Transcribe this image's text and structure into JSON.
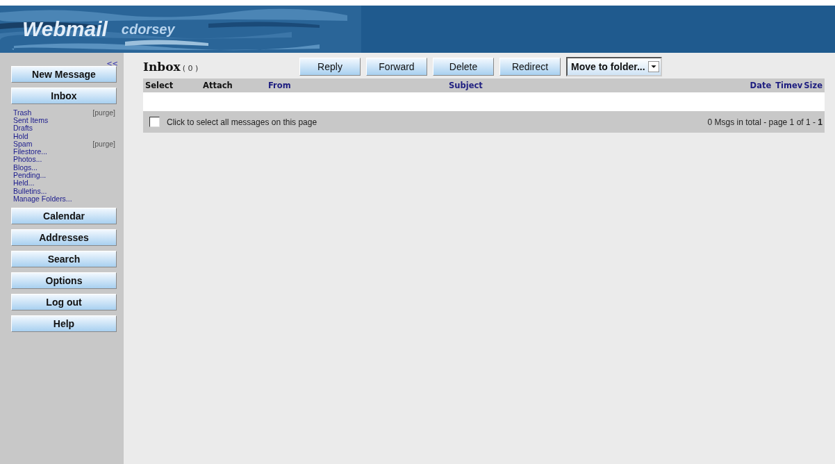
{
  "header": {
    "app_name": "Webmail",
    "user": "cdorsey"
  },
  "sidebar": {
    "collapse": "<<",
    "top_buttons": [
      "New Message",
      "Inbox"
    ],
    "folders": [
      {
        "name": "Trash",
        "action": "[purge]"
      },
      {
        "name": "Sent Items"
      },
      {
        "name": "Drafts"
      },
      {
        "name": "Hold"
      },
      {
        "name": "Spam",
        "action": "[purge]"
      },
      {
        "name": "Filestore..."
      },
      {
        "name": "Photos..."
      },
      {
        "name": "Blogs..."
      },
      {
        "name": "Pending..."
      },
      {
        "name": "Held..."
      },
      {
        "name": "Bulletins..."
      },
      {
        "name": "Manage Folders..."
      }
    ],
    "bottom_buttons": [
      "Calendar",
      "Addresses",
      "Search",
      "Options",
      "Log out",
      "Help"
    ]
  },
  "mailbox": {
    "title": "Inbox",
    "count": "( 0 )"
  },
  "toolbar": {
    "buttons": [
      "Reply",
      "Forward",
      "Delete",
      "Redirect"
    ],
    "move_select": "Move to folder..."
  },
  "table": {
    "columns": [
      {
        "label": "Select",
        "kind": "plain"
      },
      {
        "label": "Attach",
        "kind": "plain"
      },
      {
        "label": "From",
        "kind": "link"
      },
      {
        "label": "Subject",
        "kind": "link"
      },
      {
        "label": "Date",
        "kind": "link"
      },
      {
        "label": "Time",
        "kind": "link",
        "sort": "v"
      },
      {
        "label": "Size",
        "kind": "link"
      }
    ]
  },
  "footer": {
    "select_all_checked": false,
    "select_all_label": "Click to select all messages on this page",
    "paging": "0 Msgs in total - page 1 of 1 - **1**"
  }
}
